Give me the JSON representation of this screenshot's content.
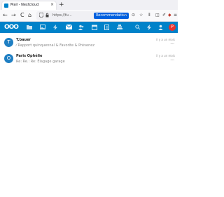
{
  "browser": {
    "tab_title": "Mail - Nextcloud",
    "tab_close": "×",
    "new_tab": "+",
    "back": "←",
    "forward": "→",
    "reload": "C",
    "home": "⌂",
    "url": "https://fu...",
    "recommendation": "Recommendation",
    "urlbar_more": "···",
    "pocket": "⊙",
    "bookmark": "☆",
    "library": "⫴",
    "sidebar": "◫",
    "extension": "✐",
    "ublock": "◆",
    "menu": "≡"
  },
  "nextcloud": {
    "logo": "OOO",
    "avatar_letter": "P"
  },
  "mails": [
    {
      "avatar": "T",
      "sender": "T.bauer",
      "subject": "Rapport quinquennal & Favorite & Prévenez",
      "subject_prefix": "⁄",
      "date": "il y a un mois",
      "more": "···"
    },
    {
      "avatar": "O",
      "sender": "Paris Ophélie",
      "subject": "Re: Re.: Re: Élagage garage",
      "date": "il y a un mois",
      "more": "···"
    }
  ],
  "colors": {
    "brand": "#0082c9",
    "avatar_user": "#e9322d",
    "mail_avatar": "#1f7fc3",
    "recommendation": "#0060df"
  }
}
